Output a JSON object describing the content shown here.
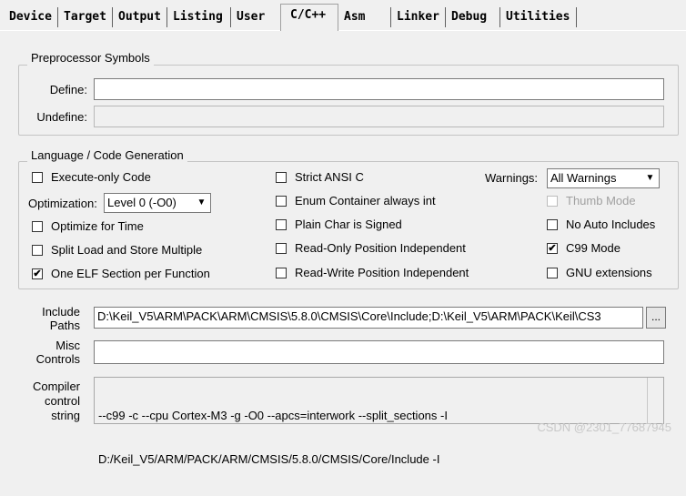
{
  "tabs": [
    {
      "label": "Device"
    },
    {
      "label": "Target"
    },
    {
      "label": "Output"
    },
    {
      "label": "Listing"
    },
    {
      "label": "User"
    },
    {
      "label": "C/C++"
    },
    {
      "label": "Asm"
    },
    {
      "label": "Linker"
    },
    {
      "label": "Debug"
    },
    {
      "label": "Utilities"
    }
  ],
  "active_tab": "C/C++",
  "preprocessor": {
    "title": "Preprocessor Symbols",
    "define_label": "Define:",
    "define_value": "",
    "undefine_label": "Undefine:",
    "undefine_value": ""
  },
  "language": {
    "title": "Language / Code Generation",
    "execute_only": {
      "label": "Execute-only Code",
      "checked": false
    },
    "optimization_label": "Optimization:",
    "optimization_value": "Level 0 (-O0)",
    "optimize_time": {
      "label": "Optimize for Time",
      "checked": false
    },
    "split_load": {
      "label": "Split Load and Store Multiple",
      "checked": false
    },
    "one_elf": {
      "label": "One ELF Section per Function",
      "checked": true,
      "mark": "✔"
    },
    "strict_ansi": {
      "label": "Strict ANSI C",
      "checked": false
    },
    "enum_container": {
      "label": "Enum Container always int",
      "checked": false
    },
    "plain_char": {
      "label": "Plain Char is Signed",
      "checked": false
    },
    "ro_pi": {
      "label": "Read-Only Position Independent",
      "checked": false
    },
    "rw_pi": {
      "label": "Read-Write Position Independent",
      "checked": false
    },
    "warnings_label": "Warnings:",
    "warnings_value": "All Warnings",
    "thumb_mode": {
      "label": "Thumb Mode",
      "checked": false,
      "disabled": true
    },
    "no_auto_includes": {
      "label": "No Auto Includes",
      "checked": false
    },
    "c99_mode": {
      "label": "C99 Mode",
      "checked": true,
      "mark": "✔"
    },
    "gnu_ext": {
      "label": "GNU extensions",
      "checked": false
    }
  },
  "include_paths": {
    "label_line1": "Include",
    "label_line2": "Paths",
    "value": "D:\\Keil_V5\\ARM\\PACK\\ARM\\CMSIS\\5.8.0\\CMSIS\\Core\\Include;D:\\Keil_V5\\ARM\\PACK\\Keil\\CS3",
    "browse_label": "..."
  },
  "misc_controls": {
    "label_line1": "Misc",
    "label_line2": "Controls",
    "value": ""
  },
  "compiler_control": {
    "label_line1": "Compiler",
    "label_line2": "control",
    "label_line3": "string",
    "line1": "--c99 -c --cpu Cortex-M3 -g -O0 --apcs=interwork --split_sections -I",
    "line2": "D:/Keil_V5/ARM/PACK/ARM/CMSIS/5.8.0/CMSIS/Core/Include -I"
  },
  "watermark": "CSDN @2301_77687945",
  "icons": {
    "dropdown": "▼"
  }
}
